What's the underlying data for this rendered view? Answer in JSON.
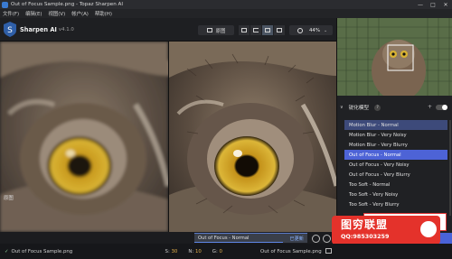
{
  "window": {
    "title": "Out of Focus Sample.png - Topaz Sharpen AI",
    "controls": [
      "—",
      "□",
      "✕"
    ]
  },
  "menu": [
    "文件(F)",
    "编辑(E)",
    "视图(V)",
    "帐户(A)",
    "帮助(H)"
  ],
  "toolbar": {
    "app_name": "Sharpen AI",
    "version": "v4.1.0",
    "compare_label": "原图",
    "zoom": "44%",
    "zoom_dropdown": "⌄"
  },
  "viewer": {
    "left_label": "原图",
    "preview_label": "Out of Focus - Normal",
    "preview_status": "已更新",
    "preview_progress": 0.78
  },
  "panel": {
    "model_title": "锐化模型",
    "help": "?",
    "chevron": "∨",
    "plus": "+",
    "models": [
      {
        "label": "Motion Blur - Normal",
        "state": "highlight"
      },
      {
        "label": "Motion Blur - Very Noisy",
        "state": ""
      },
      {
        "label": "Motion Blur - Very Blurry",
        "state": ""
      },
      {
        "label": "Out of Focus - Normal",
        "state": "selected"
      },
      {
        "label": "Out of Focus - Very Noisy",
        "state": ""
      },
      {
        "label": "Out of Focus - Very Blurry",
        "state": ""
      },
      {
        "label": "Too Soft - Normal",
        "state": ""
      },
      {
        "label": "Too Soft - Very Noisy",
        "state": ""
      },
      {
        "label": "Too Soft - Very Blurry",
        "state": ""
      }
    ]
  },
  "status": {
    "check": "✓",
    "filename": "Out of Focus Sample.png",
    "s_label": "S:",
    "s_value": "30",
    "n_label": "N:",
    "n_value": "10",
    "g_label": "G:",
    "g_value": "0",
    "filename2": "Out of Focus Sample.png"
  },
  "watermark": {
    "title": "图穷联盟",
    "qq": "QQ:985303259"
  },
  "colors": {
    "accent": "#4d63d6",
    "highlight": "#3d4a7a",
    "eye": "#d9b12a"
  }
}
